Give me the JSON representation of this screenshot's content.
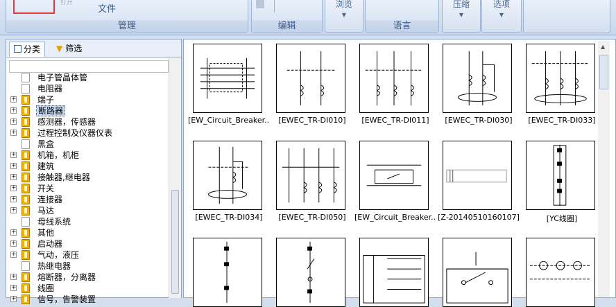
{
  "ribbon": {
    "file_label": "文件",
    "file_small_label": "打开",
    "group_manage": "管理",
    "group_edit": "编辑",
    "browse_label": "浏览",
    "group_language": "语言",
    "compress_label": "压缩",
    "options_label": "选项"
  },
  "left_panel": {
    "tab_category": "分类",
    "tab_filter": "筛选",
    "tree": [
      {
        "label": "电子管晶体管",
        "icon": "doc",
        "expandable": false
      },
      {
        "label": "电阻器",
        "icon": "doc",
        "expandable": false
      },
      {
        "label": "端子",
        "icon": "book",
        "expandable": true
      },
      {
        "label": "断路器",
        "icon": "book",
        "expandable": true
      },
      {
        "label": "感测器，传感器",
        "icon": "book",
        "expandable": true
      },
      {
        "label": "过程控制及仪器仪表",
        "icon": "book",
        "expandable": true
      },
      {
        "label": "黑盒",
        "icon": "doc",
        "expandable": false
      },
      {
        "label": "机箱，机柜",
        "icon": "book",
        "expandable": true
      },
      {
        "label": "建筑",
        "icon": "book",
        "expandable": true
      },
      {
        "label": "接触器,继电器",
        "icon": "book",
        "expandable": true
      },
      {
        "label": "开关",
        "icon": "book",
        "expandable": true
      },
      {
        "label": "连接器",
        "icon": "book",
        "expandable": true
      },
      {
        "label": "马达",
        "icon": "book",
        "expandable": true
      },
      {
        "label": "母线系统",
        "icon": "doc",
        "expandable": false
      },
      {
        "label": "其他",
        "icon": "book",
        "expandable": true
      },
      {
        "label": "启动器",
        "icon": "book",
        "expandable": true
      },
      {
        "label": "气动，液压",
        "icon": "book",
        "expandable": true
      },
      {
        "label": "热继电器",
        "icon": "doc",
        "expandable": false
      },
      {
        "label": "熔断器，分离器",
        "icon": "book",
        "expandable": true
      },
      {
        "label": "线圈",
        "icon": "book",
        "expandable": true
      },
      {
        "label": "信号，告警装置",
        "icon": "book",
        "expandable": true
      }
    ]
  },
  "gallery": {
    "items": [
      "[EW_Circuit_Breaker...",
      "[EWEC_TR-DI010]",
      "[EWEC_TR-DI011]",
      "[EWEC_TR-DI030]",
      "[EWEC_TR-DI033]",
      "[EWEC_TR-DI034]",
      "[EWEC_TR-DI050]",
      "[EW_Circuit_Breaker...",
      "[Z-20140510160107]",
      "[YC线圈]",
      "",
      "",
      "",
      "",
      ""
    ]
  },
  "colors": {
    "selection_box": "#e03b3b",
    "selected_row": "#c5d9f1",
    "ribbon_text": "#3e5b87"
  }
}
